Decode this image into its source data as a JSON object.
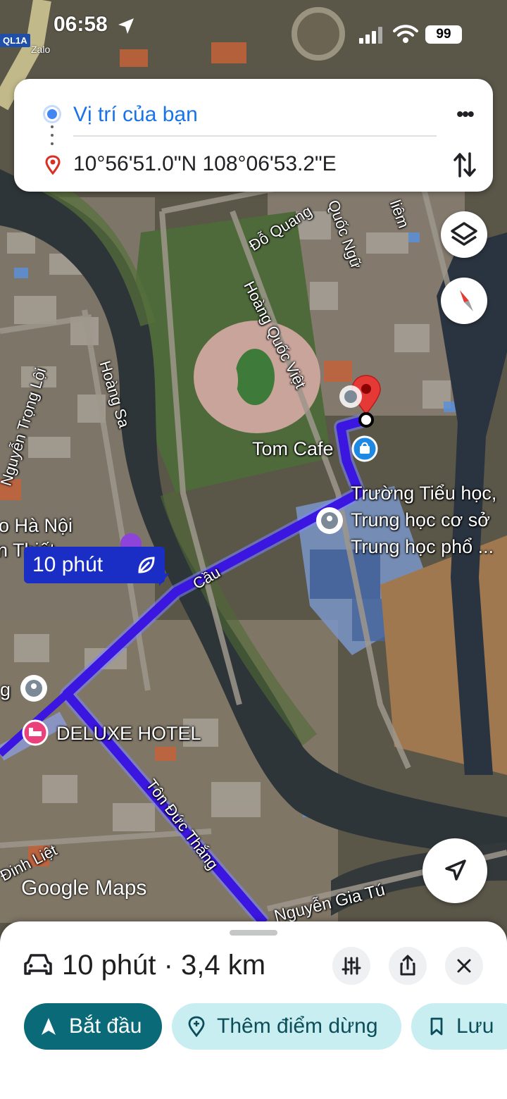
{
  "status_bar": {
    "time": "06:58",
    "back_app": "Zalo",
    "road_badge": "QL1A",
    "battery": "99"
  },
  "directions": {
    "from_label": "Vị trí của bạn",
    "to_label": "10°56'51.0\"N 108°06'53.2\"E"
  },
  "map": {
    "street_labels": {
      "do_quang": "Đỗ Quang",
      "quoc_ngu": "Quốc Ngữ",
      "liem": "liêm",
      "hoang_quoc_viet": "Hoàng Quốc Việt",
      "nguyen_trong_loi": "Nguyễn Trọng Lội",
      "hoang_sa": "Hoàng Sa",
      "cau": "Cầu",
      "ton_duc_thang": "Tôn Đức Thắng",
      "dinh_liet": "Đinh Liệt",
      "nguyen_gia_tu": "Nguyễn Gia Tú"
    },
    "places": {
      "tom_cafe": "Tom Cafe",
      "school_line1": "Trường Tiểu học,",
      "school_line2": "Trung học cơ sở",
      "school_line3": "Trung học phổ ...",
      "ha_noi_partial": "o Hà Nội",
      "thiet_partial": "n Thiết",
      "g_partial": "g",
      "deluxe_hotel": "DELUXE HOTEL"
    },
    "route_time": "10 phút",
    "attribution": "Google Maps",
    "route_color": "#3a16e0"
  },
  "bottom_sheet": {
    "summary": "10 phút · 3,4 km",
    "start_label": "Bắt đầu",
    "add_stop_label": "Thêm điểm dừng",
    "save_label": "Lưu"
  },
  "icons": [
    "car-icon",
    "tune-icon",
    "share-icon",
    "close-icon",
    "navigation-arrow-icon",
    "pin-plus-icon",
    "bookmark-icon",
    "layers-icon",
    "compass-icon",
    "my-location-icon",
    "location-pin-icon",
    "swap-icon",
    "more-icon",
    "eco-leaf-icon"
  ]
}
